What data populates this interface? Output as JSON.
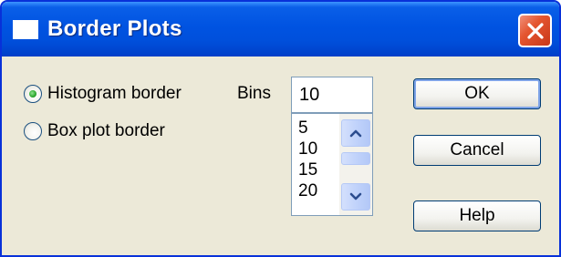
{
  "window": {
    "title": "Border Plots",
    "close_icon": "close-icon"
  },
  "border_type": {
    "options": [
      {
        "label": "Histogram border",
        "selected": true
      },
      {
        "label": "Box plot border",
        "selected": false
      }
    ]
  },
  "bins": {
    "label": "Bins",
    "value": "10",
    "list": [
      "5",
      "10",
      "15",
      "20"
    ]
  },
  "buttons": {
    "ok_label": "OK",
    "cancel_label": "Cancel",
    "help_label": "Help"
  },
  "colors": {
    "titlebar": "#0053e1",
    "close_button": "#e4552f",
    "dialog_background": "#ece9d8",
    "radio_selected_dot": "#2aa52a"
  }
}
